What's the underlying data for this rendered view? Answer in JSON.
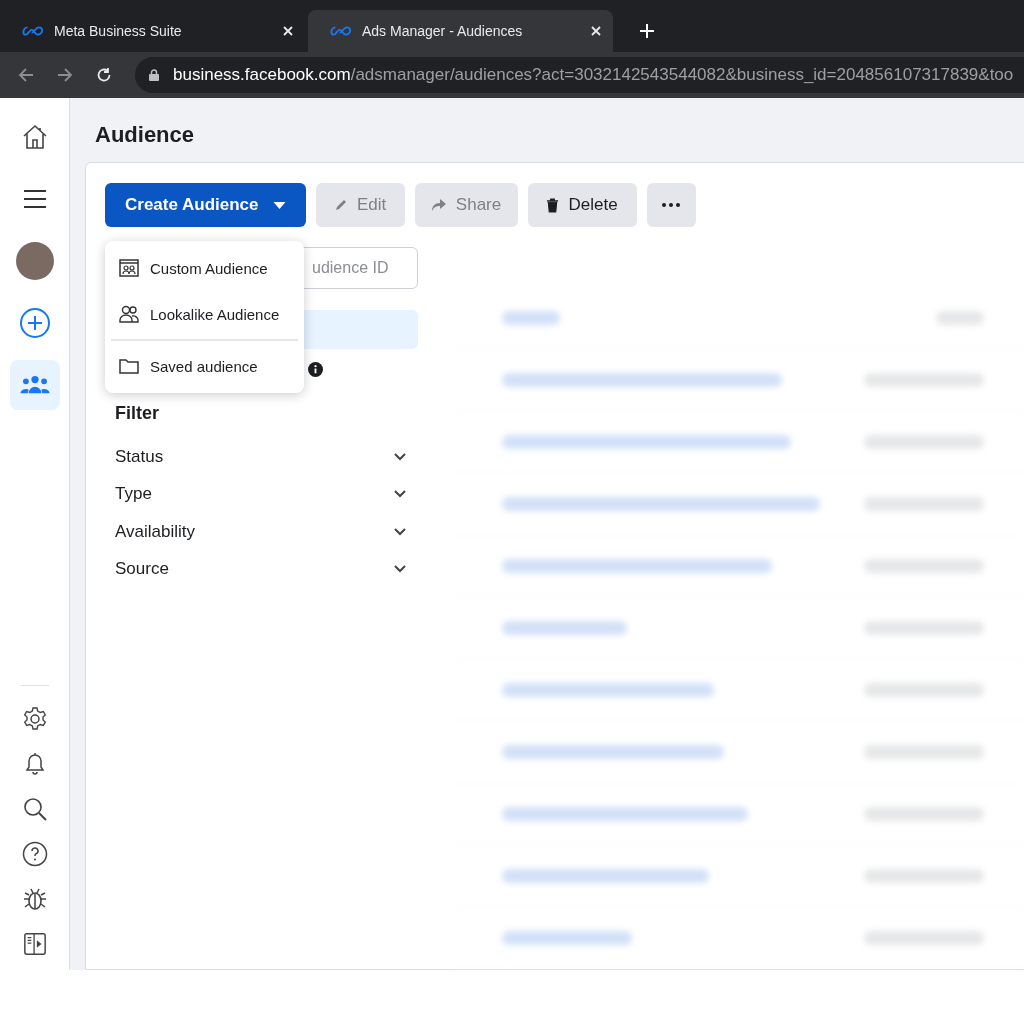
{
  "browser": {
    "tabs": [
      {
        "title": "Meta Business Suite",
        "selected": false
      },
      {
        "title": "Ads Manager - Audiences",
        "selected": true
      }
    ],
    "url": {
      "host": "business.facebook.com",
      "path": "/adsmanager/audiences?act=3032142543544082&business_id=204856107317839&too"
    }
  },
  "nav": {
    "top": [
      {
        "kind": "home",
        "selected": false
      },
      {
        "kind": "menu",
        "selected": false
      },
      {
        "kind": "avatar",
        "selected": false
      },
      {
        "kind": "create",
        "selected": false
      },
      {
        "kind": "audiences",
        "selected": true
      }
    ],
    "bottom": [
      {
        "kind": "settings",
        "selected": false
      },
      {
        "kind": "notifications",
        "selected": false
      },
      {
        "kind": "search",
        "selected": false
      },
      {
        "kind": "help",
        "selected": false
      },
      {
        "kind": "bug",
        "selected": false
      },
      {
        "kind": "panel",
        "selected": false
      }
    ]
  },
  "page_title": "Audience",
  "toolbar": {
    "buttons": [
      {
        "label": "Create Audience",
        "kind": "primary",
        "disabled": false
      },
      {
        "label": "Edit",
        "kind": "edit",
        "disabled": true
      },
      {
        "label": "Share",
        "kind": "share",
        "disabled": true
      },
      {
        "label": "Delete",
        "kind": "delete",
        "disabled": false
      },
      {
        "kind": "more"
      }
    ]
  },
  "dropdown": {
    "items": [
      {
        "label": "Custom Audience",
        "kind": "custom",
        "divider_before": false
      },
      {
        "label": "Lookalike Audience",
        "kind": "lookalike",
        "divider_before": false
      },
      {
        "label": "Saved audience",
        "kind": "saved",
        "divider_before": true
      }
    ]
  },
  "search": {
    "placeholder": "udience ID"
  },
  "filter": {
    "title": "Filter",
    "items": [
      {
        "label": "Status",
        "expanded": false
      },
      {
        "label": "Type",
        "expanded": false
      },
      {
        "label": "Availability",
        "expanded": false
      },
      {
        "label": "Source",
        "expanded": false
      }
    ]
  }
}
